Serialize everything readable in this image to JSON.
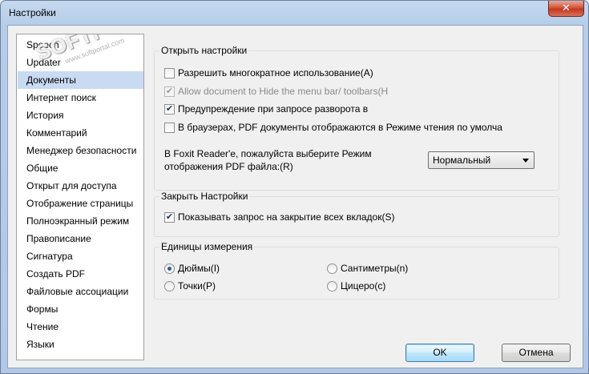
{
  "window": {
    "title": "Настройки",
    "close_label": "✕"
  },
  "watermark": {
    "text": "SOFTPORTAL",
    "sub": "www.softportal.com"
  },
  "sidebar": {
    "items": [
      {
        "label": "Speech"
      },
      {
        "label": "Updater"
      },
      {
        "label": "Документы",
        "selected": true
      },
      {
        "label": "Интернет поиск"
      },
      {
        "label": "История"
      },
      {
        "label": "Комментарий"
      },
      {
        "label": "Менеджер безопасности"
      },
      {
        "label": "Общие"
      },
      {
        "label": "Открыт для доступа"
      },
      {
        "label": "Отображение страницы"
      },
      {
        "label": "Полноэкранный режим"
      },
      {
        "label": "Правописание"
      },
      {
        "label": "Сигнатура"
      },
      {
        "label": "Создать PDF"
      },
      {
        "label": "Файловые ассоциации"
      },
      {
        "label": "Формы"
      },
      {
        "label": "Чтение"
      },
      {
        "label": "Языки"
      }
    ]
  },
  "open_settings": {
    "title": "Открыть настройки",
    "opt1": {
      "label": "Разрешить многократное использование(A)",
      "checked": false
    },
    "opt2": {
      "label": "Allow document to Hide the menu bar/ toolbars(H",
      "checked": true,
      "disabled": true
    },
    "opt3": {
      "label": "Предупреждение при запросе разворота в",
      "checked": true
    },
    "opt4": {
      "label": "В браузерах, PDF документы отображаются в Режиме чтения по умолча",
      "checked": false
    },
    "mode_label_1": "В Foxit Reader'e, пожалуйста выберите Режим",
    "mode_label_2": "отображения PDF файла:(R)",
    "mode_value": "Нормальный"
  },
  "close_settings": {
    "title": "Закрыть Настройки",
    "opt1": {
      "label": "Показывать запрос на закрытие всех вкладок(S)",
      "checked": true
    }
  },
  "units": {
    "title": "Единицы измерения",
    "inches": "Дюймы(I)",
    "cm": "Сантиметры(n)",
    "points": "Точки(P)",
    "cicero": "Цицеро(c)",
    "selected": "inches"
  },
  "buttons": {
    "ok": "OK",
    "cancel": "Отмена"
  }
}
